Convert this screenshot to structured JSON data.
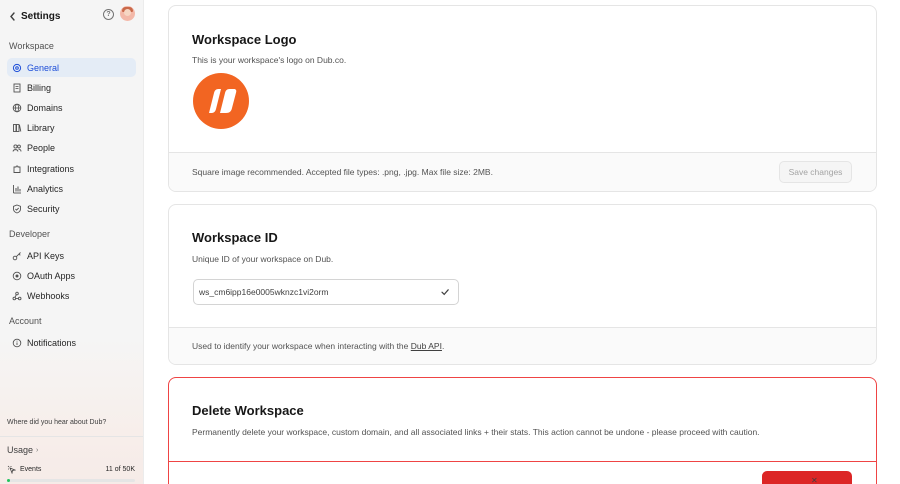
{
  "sidebar": {
    "title": "Settings",
    "sections": {
      "workspace": "Workspace",
      "developer": "Developer",
      "account": "Account"
    },
    "items": [
      {
        "label": "General",
        "icon": "gear-icon",
        "active": true
      },
      {
        "label": "Billing",
        "icon": "receipt-icon"
      },
      {
        "label": "Domains",
        "icon": "globe-icon"
      },
      {
        "label": "Library",
        "icon": "book-icon"
      },
      {
        "label": "People",
        "icon": "users-icon"
      },
      {
        "label": "Integrations",
        "icon": "puzzle-icon"
      },
      {
        "label": "Analytics",
        "icon": "chart-icon"
      },
      {
        "label": "Security",
        "icon": "shield-icon"
      },
      {
        "label": "API Keys",
        "icon": "key-icon"
      },
      {
        "label": "OAuth Apps",
        "icon": "oauth-icon"
      },
      {
        "label": "Webhooks",
        "icon": "webhook-icon"
      },
      {
        "label": "Notifications",
        "icon": "info-icon"
      }
    ],
    "referral_prompt": "Where did you hear about Dub?",
    "usage": {
      "label": "Usage",
      "events_label": "Events",
      "events_count": "11 of 50K",
      "events_fraction": 0.0002
    }
  },
  "logo_card": {
    "title": "Workspace Logo",
    "description": "This is your workspace's logo on Dub.co.",
    "footer_text": "Square image recommended. Accepted file types: .png, .jpg. Max file size: 2MB.",
    "save_label": "Save changes"
  },
  "id_card": {
    "title": "Workspace ID",
    "description": "Unique ID of your workspace on Dub.",
    "workspace_id": "ws_cm6ipp16e0005wknzc1vi2orm",
    "footer_prefix": "Used to identify your workspace when interacting with the",
    "footer_link": "Dub API",
    "footer_suffix": "."
  },
  "delete_card": {
    "title": "Delete Workspace",
    "description": "Permanently delete your workspace, custom domain, and all associated links + their stats. This action cannot be undone - please proceed with caution."
  },
  "colors": {
    "accent": "#1d4ed8",
    "logo": "#f26522",
    "danger": "#dc2626"
  }
}
